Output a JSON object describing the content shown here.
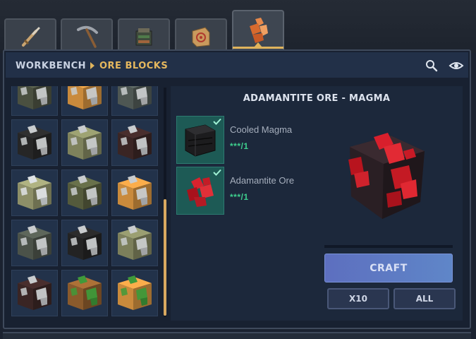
{
  "tabs": [
    {
      "icon": "sword-icon",
      "active": false
    },
    {
      "icon": "pickaxe-icon",
      "active": false
    },
    {
      "icon": "workbench-icon",
      "active": false
    },
    {
      "icon": "target-block-icon",
      "active": false
    },
    {
      "icon": "ore-crystal-icon",
      "active": true
    }
  ],
  "header": {
    "breadcrumb_root": "WORKBENCH",
    "breadcrumb_current": "ORE BLOCKS",
    "search_icon": "search-icon",
    "view_icon": "eye-icon"
  },
  "grid": {
    "items": [
      {
        "icon": "ore-block-icon",
        "base": "#4a5040",
        "ore": "#c9ccce"
      },
      {
        "icon": "ore-block-icon",
        "base": "#c98a3c",
        "ore": "#c9ccce"
      },
      {
        "icon": "ore-block-icon",
        "base": "#4e5753",
        "ore": "#c9ccce"
      },
      {
        "icon": "ore-block-icon",
        "base": "#262626",
        "ore": "#c9ccce"
      },
      {
        "icon": "ore-block-icon",
        "base": "#7e825c",
        "ore": "#c9ccce"
      },
      {
        "icon": "ore-block-icon",
        "base": "#3a2524",
        "ore": "#c9ccce"
      },
      {
        "icon": "ore-block-icon",
        "base": "#8d8f68",
        "ore": "#dfe3e6"
      },
      {
        "icon": "ore-block-icon",
        "base": "#545a3c",
        "ore": "#c9ccce"
      },
      {
        "icon": "ore-block-icon",
        "base": "#c98a3c",
        "ore": "#c9ccce"
      },
      {
        "icon": "ore-block-icon",
        "base": "#4b5249",
        "ore": "#c9ccce"
      },
      {
        "icon": "ore-block-icon",
        "base": "#232323",
        "ore": "#c9ccce"
      },
      {
        "icon": "ore-block-icon",
        "base": "#7c7f5b",
        "ore": "#c9ccce"
      },
      {
        "icon": "ore-block-icon",
        "base": "#3a2524",
        "ore": "#c9ccce"
      },
      {
        "icon": "ore-block-icon",
        "base": "#8a5a2c",
        "ore": "#3f9a3a"
      },
      {
        "icon": "ore-block-icon",
        "base": "#c98a3c",
        "ore": "#3f9a3a"
      }
    ],
    "scroll_position": 0.5
  },
  "recipe": {
    "title": "ADAMANTITE ORE - MAGMA",
    "ingredients": [
      {
        "name": "Cooled Magma",
        "count": "***/1",
        "icon": "cooled-magma-icon",
        "check_icon": "check-icon"
      },
      {
        "name": "Adamantite Ore",
        "count": "***/1",
        "icon": "adamantite-ore-icon",
        "check_icon": "check-icon"
      }
    ],
    "preview_icon": "adamantite-magma-block-icon",
    "craft_progress": 0
  },
  "actions": {
    "craft_label": "CRAFT",
    "x10_label": "X10",
    "all_label": "ALL"
  },
  "colors": {
    "accent": "#e0b45c",
    "header_bg": "#223048",
    "ingredient_ok": "#3ecf8e",
    "craft_button": "#5f7ec4"
  }
}
